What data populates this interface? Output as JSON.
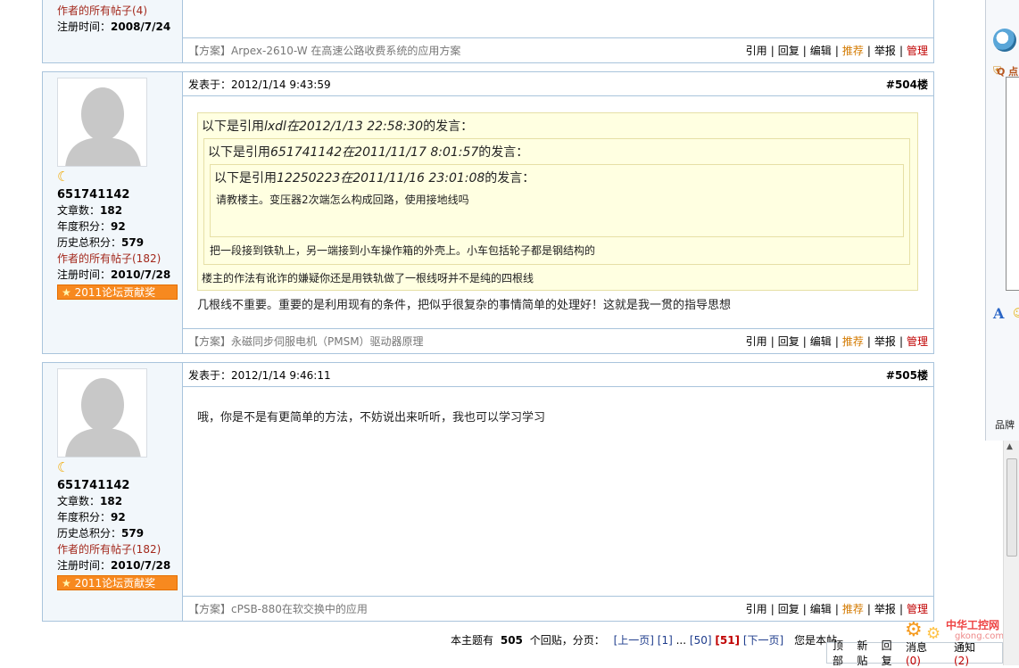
{
  "post_prev": {
    "link_label": "作者的所有帖子(4)",
    "reg_label": "注册时间：",
    "reg_value": "2008/7/24",
    "signature": "【方案】Arpex-2610-W 在高速公路收费系统的应用方案",
    "actions": [
      "引用",
      "回复",
      "编辑",
      "推荐",
      "举报",
      "管理"
    ]
  },
  "post_504": {
    "time": "发表于：2012/1/14 9:43:59",
    "floor": "#504楼",
    "username": "651741142",
    "articles_label": "文章数：",
    "articles": "182",
    "year_label": "年度积分：",
    "year": "92",
    "hist_label": "历史总积分：",
    "hist": "579",
    "link_label": "作者的所有帖子(182)",
    "reg_label": "注册时间：",
    "reg_value": "2010/7/28",
    "award": "2011论坛贡献奖",
    "quote1_pre": "以下是引用",
    "quote1_user": "lxdl",
    "quote1_mid": "在",
    "quote1_time": "2012/1/13 22:58:30",
    "quote1_post": "的发言：",
    "quote2_pre": "以下是引用",
    "quote2_user": "651741142",
    "quote2_mid": "在",
    "quote2_time": "2011/11/17 8:01:57",
    "quote2_post": "的发言：",
    "quote3_pre": "以下是引用",
    "quote3_user": "12250223",
    "quote3_mid": "在",
    "quote3_time": "2011/11/16 23:01:08",
    "quote3_post": "的发言：",
    "quote3_body": "请教楼主。变压器2次端怎么构成回路，使用接地线吗",
    "quote2_body": "把一段接到铁轨上，另一端接到小车操作箱的外壳上。小车包括轮子都是钢结构的",
    "quote1_body": "楼主的作法有讹诈的嫌疑你还是用铁轨做了一根线呀并不是纯的四根线",
    "body": "几根线不重要。重要的是利用现有的条件，把似乎很复杂的事情简单的处理好！这就是我一贯的指导思想",
    "signature": "【方案】永磁同步伺服电机（PMSM）驱动器原理",
    "actions": [
      "引用",
      "回复",
      "编辑",
      "推荐",
      "举报",
      "管理"
    ]
  },
  "post_505": {
    "time": "发表于：2012/1/14 9:46:11",
    "floor": "#505楼",
    "username": "651741142",
    "articles_label": "文章数：",
    "articles": "182",
    "year_label": "年度积分：",
    "year": "92",
    "hist_label": "历史总积分：",
    "hist": "579",
    "link_label": "作者的所有帖子(182)",
    "reg_label": "注册时间：",
    "reg_value": "2010/7/28",
    "award": "2011论坛贡献奖",
    "body": "哦，你是不是有更简单的方法，不妨说出来听听，我也可以学习学习",
    "signature": "【方案】cPSB-880在软交换中的应用",
    "actions": [
      "引用",
      "回复",
      "编辑",
      "推荐",
      "举报",
      "管理"
    ]
  },
  "pager": {
    "prefix": "本主题有",
    "count": "505",
    "suffix": "个回贴，分页：",
    "prev": "[上一页]",
    "p1": "[1]",
    "dots": "...",
    "p50": "[50]",
    "p51": "[51]",
    "next": "[下一页]",
    "tail": "您是本帖"
  },
  "bottom_bar": {
    "top": "顶部",
    "new": "新贴",
    "reply": "回复",
    "msg": "消息",
    "msg_count": "(0)",
    "notice": "通知",
    "notice_count": "(2)"
  },
  "watermark": {
    "name": "中华工控网",
    "domain": "gkong.com"
  },
  "side_panel": {
    "label": "Q 点",
    "font_label": "A",
    "brand": "品牌"
  },
  "colors": {
    "border": "#a9c4dc",
    "recommend": "#d37a00",
    "manage": "#c00000",
    "award_bg": "#f7891f",
    "quote_bg": "#ffffe1"
  }
}
